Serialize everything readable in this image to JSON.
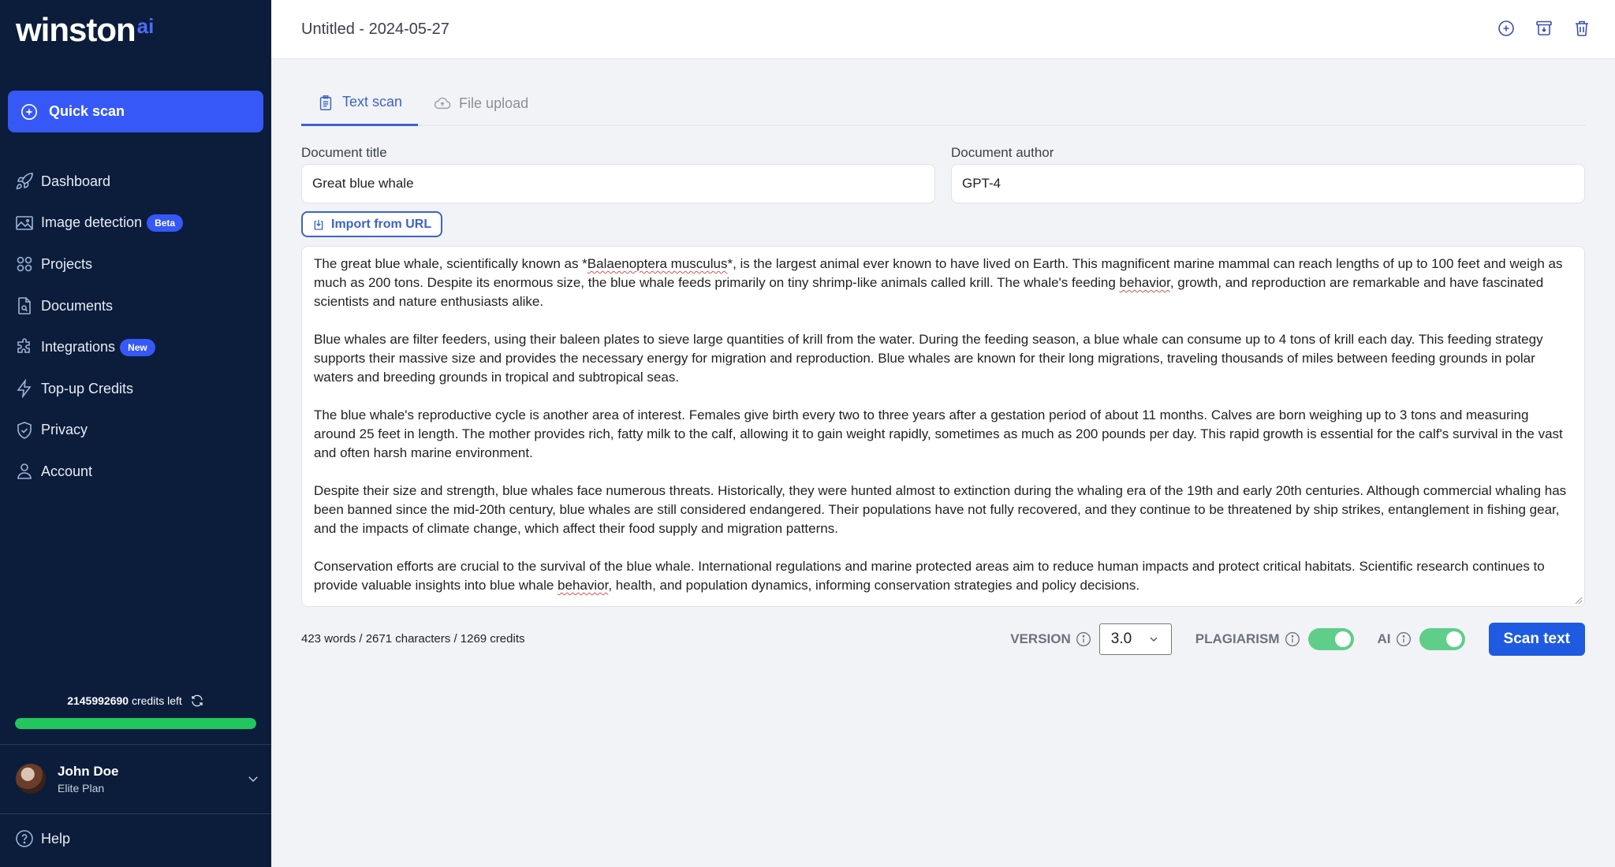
{
  "brand": {
    "name": "winston",
    "suffix": "ai"
  },
  "sidebar": {
    "quick_scan": "Quick scan",
    "items": [
      {
        "label": "Dashboard",
        "icon": "rocket-icon"
      },
      {
        "label": "Image detection",
        "icon": "image-icon",
        "badge": "Beta"
      },
      {
        "label": "Projects",
        "icon": "grid-icon"
      },
      {
        "label": "Documents",
        "icon": "document-search-icon"
      },
      {
        "label": "Integrations",
        "icon": "puzzle-icon",
        "badge": "New"
      },
      {
        "label": "Top-up Credits",
        "icon": "lightning-icon"
      },
      {
        "label": "Privacy",
        "icon": "shield-check-icon"
      },
      {
        "label": "Account",
        "icon": "user-icon"
      }
    ],
    "credits": {
      "count": "2145992690",
      "suffix": "credits left",
      "fill_fraction": 1.0,
      "bar_color": "#22c55e"
    },
    "user": {
      "name": "John Doe",
      "plan": "Elite Plan"
    },
    "help": "Help"
  },
  "header": {
    "title": "Untitled - 2024-05-27",
    "actions": [
      "add-icon",
      "archive-icon",
      "trash-icon"
    ]
  },
  "tabs": [
    {
      "label": "Text scan",
      "active": true
    },
    {
      "label": "File upload",
      "active": false
    }
  ],
  "form": {
    "title_label": "Document title",
    "title_value": "Great blue whale",
    "author_label": "Document author",
    "author_value": "GPT-4",
    "import_label": "Import from URL",
    "paragraphs": [
      "The great blue whale, scientifically known as *Balaenoptera musculus*, is the largest animal ever known to have lived on Earth. This magnificent marine mammal can reach lengths of up to 100 feet and weigh as much as 200 tons. Despite its enormous size, the blue whale feeds primarily on tiny shrimp-like animals called krill. The whale's feeding behavior, growth, and reproduction are remarkable and have fascinated scientists and nature enthusiasts alike.",
      "Blue whales are filter feeders, using their baleen plates to sieve large quantities of krill from the water. During the feeding season, a blue whale can consume up to 4 tons of krill each day. This feeding strategy supports their massive size and provides the necessary energy for migration and reproduction. Blue whales are known for their long migrations, traveling thousands of miles between feeding grounds in polar waters and breeding grounds in tropical and subtropical seas.",
      "The blue whale's reproductive cycle is another area of interest. Females give birth every two to three years after a gestation period of about 11 months. Calves are born weighing up to 3 tons and measuring around 25 feet in length. The mother provides rich, fatty milk to the calf, allowing it to gain weight rapidly, sometimes as much as 200 pounds per day. This rapid growth is essential for the calf's survival in the vast and often harsh marine environment.",
      "Despite their size and strength, blue whales face numerous threats. Historically, they were hunted almost to extinction during the whaling era of the 19th and early 20th centuries. Although commercial whaling has been banned since the mid-20th century, blue whales are still considered endangered. Their populations have not fully recovered, and they continue to be threatened by ship strikes, entanglement in fishing gear, and the impacts of climate change, which affect their food supply and migration patterns.",
      "Conservation efforts are crucial to the survival of the blue whale. International regulations and marine protected areas aim to reduce human impacts and protect critical habitats. Scientific research continues to provide valuable insights into blue whale behavior, health, and population dynamics, informing conservation strategies and policy decisions."
    ]
  },
  "footer": {
    "stats": "423 words / 2671 characters / 1269 credits",
    "version_label": "VERSION",
    "version_value": "3.0",
    "plagiarism_label": "PLAGIARISM",
    "plagiarism_on": true,
    "ai_label": "AI",
    "ai_on": true,
    "scan_label": "Scan text"
  }
}
